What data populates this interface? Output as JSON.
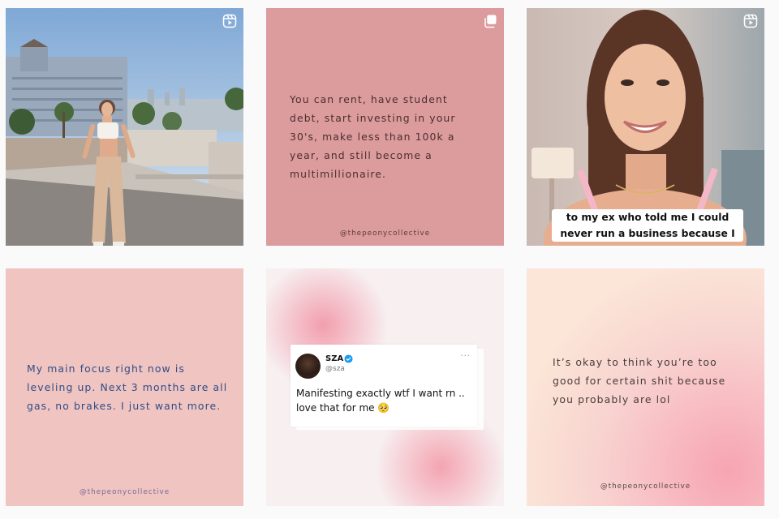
{
  "colors": {
    "page_bg": "#fafafa",
    "quote_blue": "#2f4d87",
    "pink_tile": "#dc9b9d",
    "verified_blue": "#1d9bf0"
  },
  "posts": [
    {
      "type": "reel",
      "icon": "reels-icon",
      "alt_scene": "woman standing on rooftop with city skyline"
    },
    {
      "type": "carousel",
      "icon": "carousel-icon",
      "quote": "You can rent, have student debt, start investing in your 30's, make less than 100k a year, and still become a multimillionaire.",
      "handle": "@thepeonycollective"
    },
    {
      "type": "reel",
      "icon": "reels-icon",
      "caption": "to my ex who told me I could never run a business because I"
    },
    {
      "type": "image",
      "quote": "My main focus right now is leveling up. Next 3 months are all gas, no brakes. I just want more.",
      "handle": "@thepeonycollective"
    },
    {
      "type": "image",
      "tweet": {
        "name": "SZA",
        "username": "@sza",
        "more": "···",
        "text": "Manifesting exactly wtf I want rn .. love that for me 🥺"
      }
    },
    {
      "type": "image",
      "quote": "It’s okay to think you’re too good for certain shit because you probably are lol",
      "handle": "@thepeonycollective"
    }
  ]
}
